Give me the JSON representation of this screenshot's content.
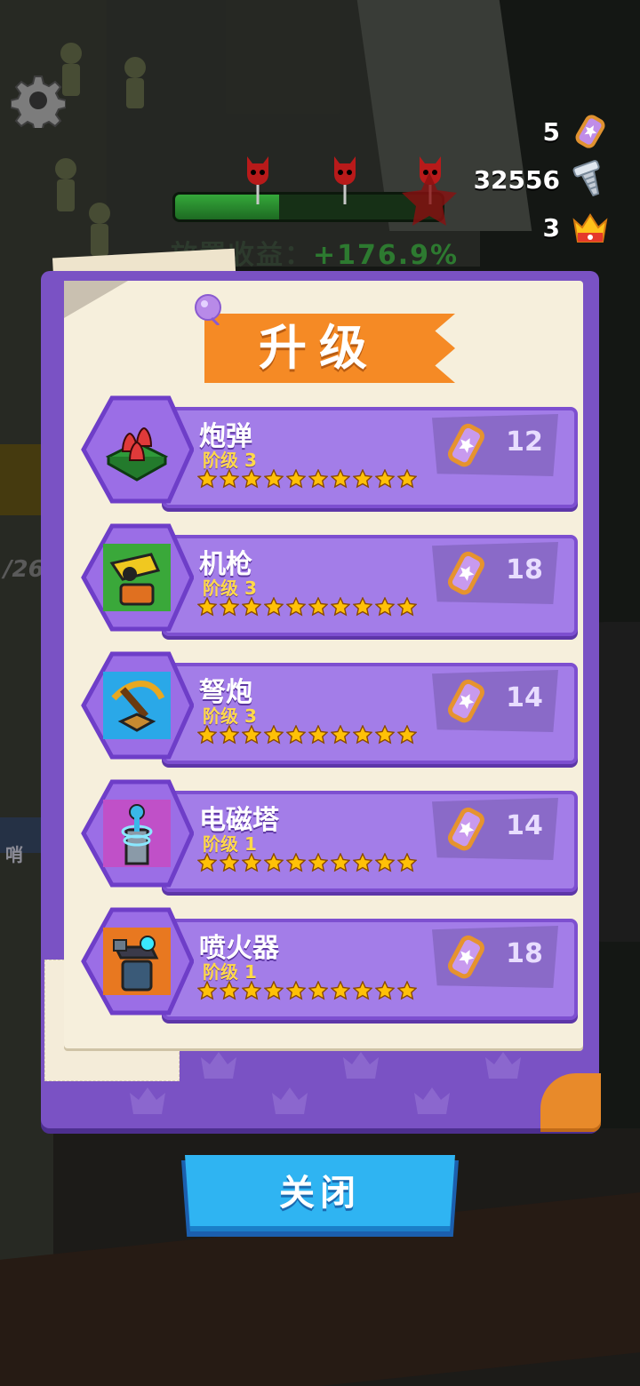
{
  "hud": {
    "tickets": "5",
    "bolts": "32556",
    "crowns": "3",
    "offline_label": "放置收益：",
    "offline_value": "+176.9%",
    "wave_progress": 0.39
  },
  "background": {
    "counter_text": "/26",
    "sign_text": "哨"
  },
  "panel": {
    "title": "升级",
    "items": [
      {
        "name": "炮弹",
        "level": "阶级 3",
        "stars": 10,
        "price": "12",
        "icon": "mortar-icon"
      },
      {
        "name": "机枪",
        "level": "阶级 3",
        "stars": 10,
        "price": "18",
        "icon": "gatling-icon"
      },
      {
        "name": "弩炮",
        "level": "阶级 3",
        "stars": 10,
        "price": "14",
        "icon": "crossbow-icon"
      },
      {
        "name": "电磁塔",
        "level": "阶级 1",
        "stars": 10,
        "price": "14",
        "icon": "tesla-tower-icon"
      },
      {
        "name": "喷火器",
        "level": "阶级 1",
        "stars": 10,
        "price": "18",
        "icon": "flamethrower-icon"
      }
    ]
  },
  "close_button": {
    "label": "关闭"
  },
  "colors": {
    "panel": "#7a52c4",
    "banner": "#f58a25",
    "button": "#2fb4f2",
    "star": "#ffc107"
  }
}
